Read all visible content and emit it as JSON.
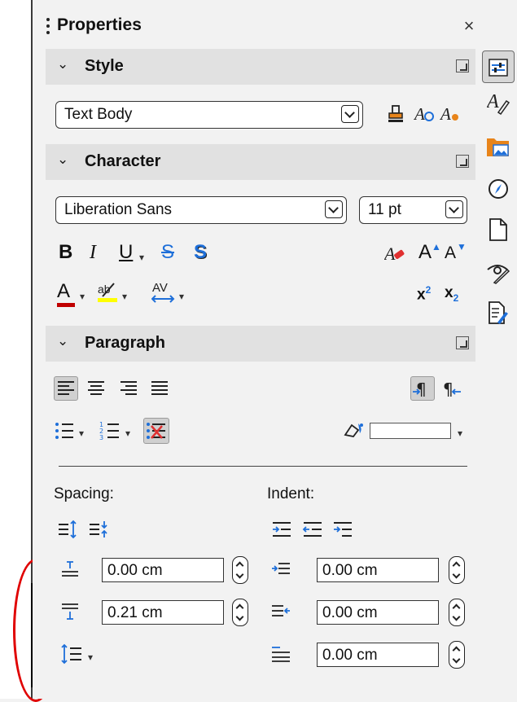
{
  "panel": {
    "title": "Properties",
    "close_glyph": "×",
    "menu_glyph": "≡"
  },
  "style_section": {
    "label": "Style",
    "paragraph_style": "Text Body",
    "icons": [
      "fill-format-icon",
      "update-style-icon",
      "new-style-icon"
    ]
  },
  "character_section": {
    "label": "Character",
    "font_name": "Liberation Sans",
    "font_size": "11 pt",
    "bold": "B",
    "italic": "I",
    "underline": "U",
    "strike": "S",
    "shadow": "S",
    "font_color": "A",
    "spacing": "AV",
    "superscript_base": "x",
    "superscript_exp": "2",
    "subscript_base": "x",
    "subscript_exp": "2",
    "grow": "A",
    "shrink": "A",
    "font_color_hex": "#c00000",
    "highlight_color_hex": "#ffff00"
  },
  "paragraph_section": {
    "label": "Paragraph",
    "spacing_label": "Spacing:",
    "indent_label": "Indent:",
    "above_spacing": "0.00 cm",
    "below_spacing": "0.21 cm",
    "before_indent": "0.00 cm",
    "after_indent": "0.00 cm",
    "first_line_indent": "0.00 cm"
  },
  "colors": {
    "accent_blue": "#1e6fd9",
    "accent_orange": "#e8841a",
    "selection_border": "#e00000"
  }
}
